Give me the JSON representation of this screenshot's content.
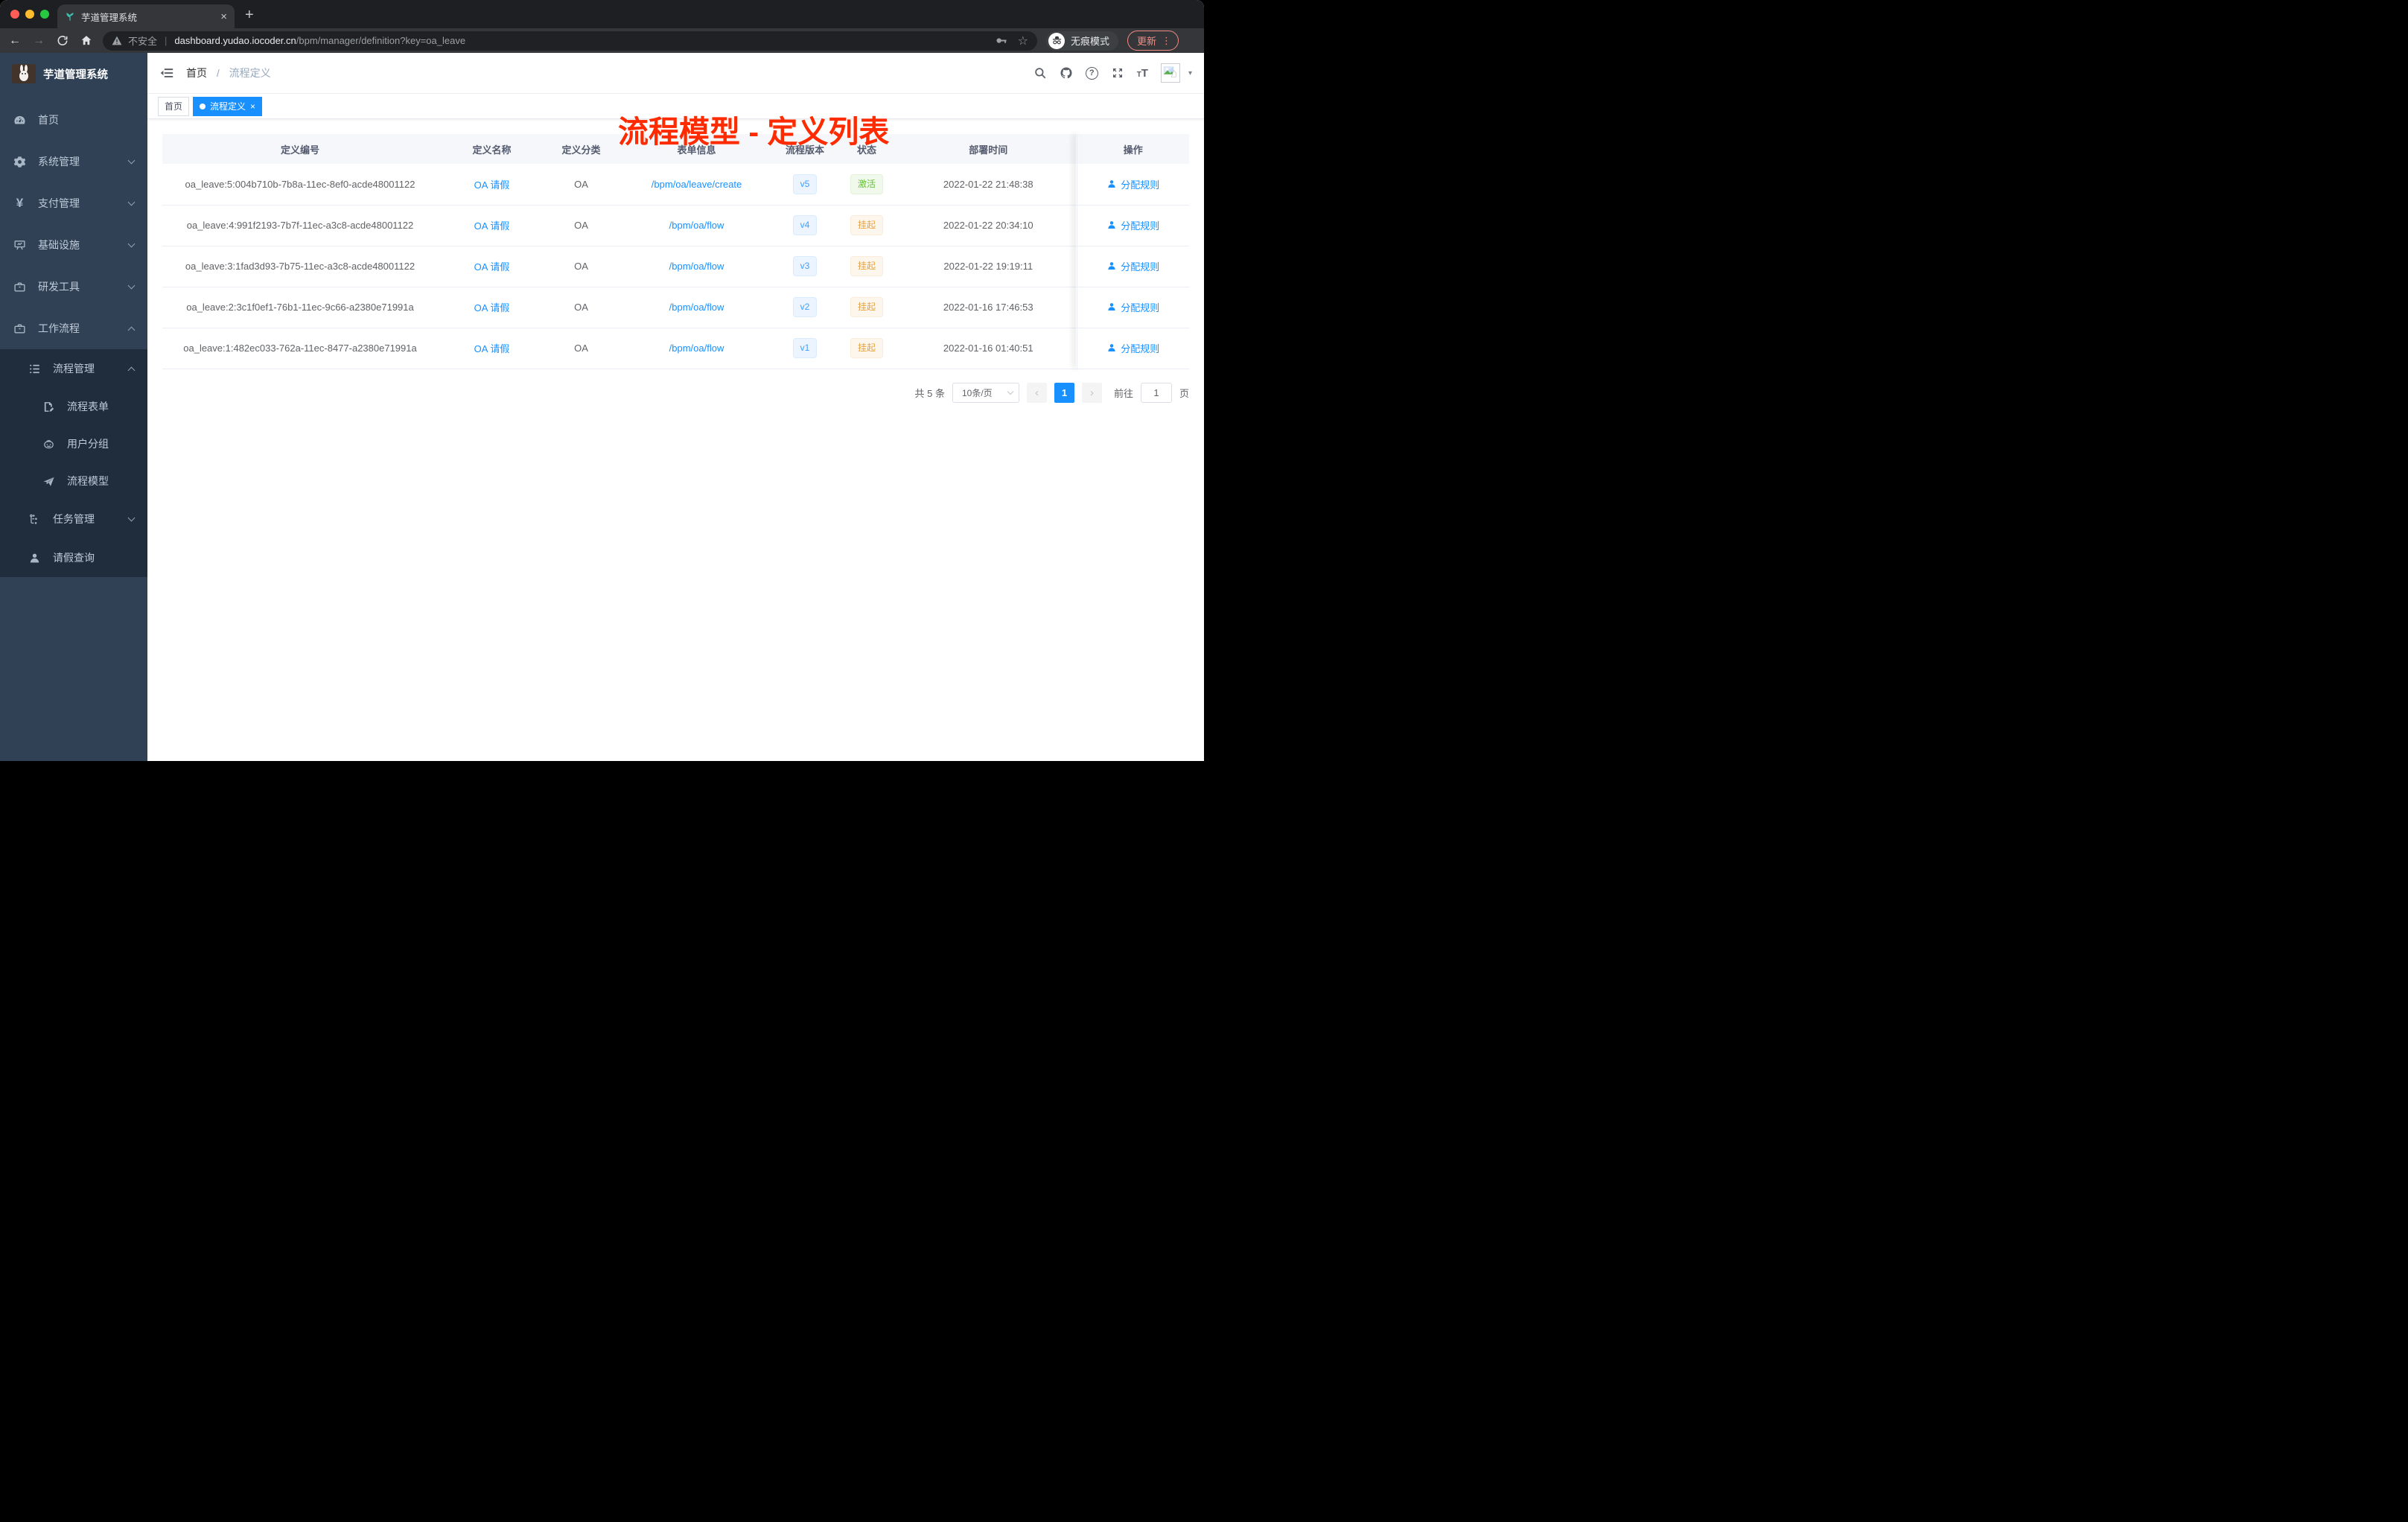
{
  "colors": {
    "accent": "#1890ff",
    "annotation_red": "#fe2b00",
    "success": "#67c23a",
    "warning": "#e6a23c",
    "sidebar_bg": "#304156",
    "submenu_bg": "#1f2d3d"
  },
  "browser": {
    "tab_title": "芋道管理系统",
    "tab_close": "×",
    "new_tab": "+",
    "back": "←",
    "forward": "→",
    "security_label": "不安全",
    "url_host": "dashboard.yudao.iocoder.cn",
    "url_path": "/bpm/manager/definition?key=oa_leave",
    "incognito_label": "无痕模式",
    "update_label": "更新",
    "menu_dots": "⋮",
    "star": "☆",
    "avatar_caret": "▾"
  },
  "sidebar": {
    "logo_title": "芋道管理系统",
    "items": [
      {
        "label": "首页"
      },
      {
        "label": "系统管理"
      },
      {
        "label": "支付管理"
      },
      {
        "label": "基础设施"
      },
      {
        "label": "研发工具"
      },
      {
        "label": "工作流程"
      }
    ],
    "submenu": {
      "process_mgmt": {
        "label": "流程管理"
      },
      "children": [
        {
          "label": "流程表单"
        },
        {
          "label": "用户分组"
        },
        {
          "label": "流程模型"
        }
      ],
      "task_mgmt": {
        "label": "任务管理"
      },
      "leave_query": {
        "label": "请假查询"
      }
    }
  },
  "header": {
    "breadcrumb": {
      "root": "首页",
      "separator": "/",
      "current": "流程定义"
    },
    "annotation": "流程模型 - 定义列表"
  },
  "tags": {
    "home": "首页",
    "active": "流程定义",
    "close": "×"
  },
  "table": {
    "columns": [
      "定义编号",
      "定义名称",
      "定义分类",
      "表单信息",
      "流程版本",
      "状态",
      "部署时间",
      "操作"
    ],
    "rows": [
      {
        "id": "oa_leave:5:004b710b-7b8a-11ec-8ef0-acde48001122",
        "name": "OA 请假",
        "category": "OA",
        "form": "/bpm/oa/leave/create",
        "version": "v5",
        "status": "激活",
        "deployed_at": "2022-01-22 21:48:38",
        "action": "分配规则"
      },
      {
        "id": "oa_leave:4:991f2193-7b7f-11ec-a3c8-acde48001122",
        "name": "OA 请假",
        "category": "OA",
        "form": "/bpm/oa/flow",
        "version": "v4",
        "status": "挂起",
        "deployed_at": "2022-01-22 20:34:10",
        "action": "分配规则"
      },
      {
        "id": "oa_leave:3:1fad3d93-7b75-11ec-a3c8-acde48001122",
        "name": "OA 请假",
        "category": "OA",
        "form": "/bpm/oa/flow",
        "version": "v3",
        "status": "挂起",
        "deployed_at": "2022-01-22 19:19:11",
        "action": "分配规则"
      },
      {
        "id": "oa_leave:2:3c1f0ef1-76b1-11ec-9c66-a2380e71991a",
        "name": "OA 请假",
        "category": "OA",
        "form": "/bpm/oa/flow",
        "version": "v2",
        "status": "挂起",
        "deployed_at": "2022-01-16 17:46:53",
        "action": "分配规则"
      },
      {
        "id": "oa_leave:1:482ec033-762a-11ec-8477-a2380e71991a",
        "name": "OA 请假",
        "category": "OA",
        "form": "/bpm/oa/flow",
        "version": "v1",
        "status": "挂起",
        "deployed_at": "2022-01-16 01:40:51",
        "action": "分配规则"
      }
    ]
  },
  "pagination": {
    "total": "共 5 条",
    "page_size": "10条/页",
    "prev": "‹",
    "page": "1",
    "next": "›",
    "goto_label": "前往",
    "goto_value": "1",
    "goto_unit": "页"
  }
}
